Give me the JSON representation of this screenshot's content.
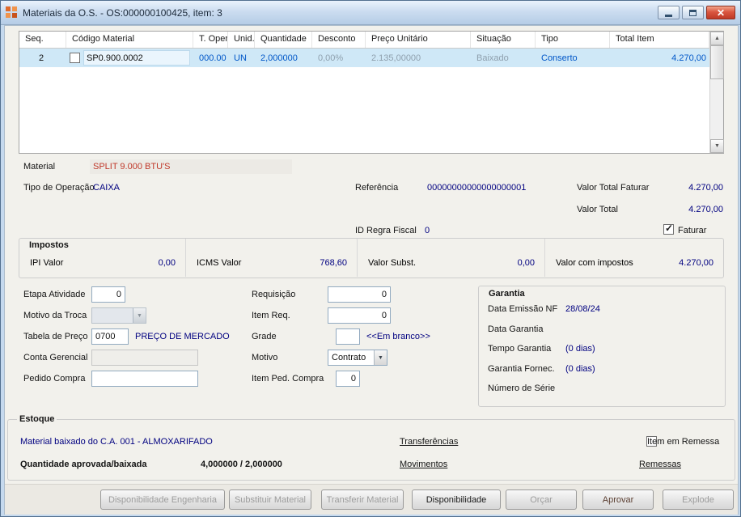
{
  "window": {
    "title": "Materiais da O.S. - OS:000000100425, item: 3"
  },
  "icons": {
    "chevron_down": "▼",
    "scroll_up": "▲",
    "scroll_down": "▼",
    "check": "✓",
    "close": "✕"
  },
  "colors": {
    "value_navy": "#000080",
    "material_red": "#c0392b",
    "row_blue": "#0057c8",
    "row_muted": "#8fa0ae",
    "selection": "#cfe8f7"
  },
  "grid": {
    "headers": [
      "Seq.",
      "Código Material",
      "T. Oper",
      "Unid.",
      "Quantidade",
      "Desconto",
      "Preço Unitário",
      "Situação",
      "Tipo",
      "Total Item"
    ],
    "row": {
      "seq": "2",
      "codigo_material": "SP0.900.0002",
      "t_oper": "000.00",
      "unid": "UN",
      "quantidade": "2,000000",
      "desconto": "0,00%",
      "preco_unitario": "2.135,00000",
      "situacao": "Baixado",
      "tipo": "Conserto",
      "total_item": "4.270,00"
    }
  },
  "detail": {
    "material_label": "Material",
    "material_value": "SPLIT 9.000 BTU'S",
    "tipo_operacao_label": "Tipo de Operação",
    "tipo_operacao_value": "CAIXA",
    "referencia_label": "Referência",
    "referencia_value": "00000000000000000001",
    "valor_total_faturar_label": "Valor Total Faturar",
    "valor_total_faturar_value": "4.270,00",
    "valor_total_label": "Valor Total",
    "valor_total_value": "4.270,00",
    "id_regra_fiscal_label": "ID Regra Fiscal",
    "id_regra_fiscal_value": "0",
    "faturar_label": "Faturar"
  },
  "impostos": {
    "title": "Impostos",
    "cells": [
      {
        "label": "IPI Valor",
        "value": "0,00"
      },
      {
        "label": "ICMS Valor",
        "value": "768,60"
      },
      {
        "label": "Valor Subst.",
        "value": "0,00"
      },
      {
        "label": "Valor com impostos",
        "value": "4.270,00"
      }
    ]
  },
  "form": {
    "etapa_atividade_label": "Etapa Atividade",
    "etapa_atividade_value": "0",
    "motivo_troca_label": "Motivo da Troca",
    "motivo_troca_value": "",
    "tabela_preco_label": "Tabela de Preço",
    "tabela_preco_value": "0700",
    "tabela_preco_desc": "PREÇO DE MERCADO",
    "conta_gerencial_label": "Conta Gerencial",
    "conta_gerencial_value": "",
    "pedido_compra_label": "Pedido Compra",
    "pedido_compra_value": "",
    "requisicao_label": "Requisição",
    "requisicao_value": "0",
    "item_req_label": "Item Req.",
    "item_req_value": "0",
    "grade_label": "Grade",
    "grade_value": "",
    "grade_hint": "<<Em branco>>",
    "motivo_label": "Motivo",
    "motivo_value": "Contrato",
    "item_ped_compra_label": "Item Ped. Compra",
    "item_ped_compra_value": "0"
  },
  "garantia": {
    "title": "Garantia",
    "data_emissao_label": "Data Emissão NF",
    "data_emissao_value": "28/08/24",
    "data_garantia_label": "Data Garantia",
    "data_garantia_value": "",
    "tempo_garantia_label": "Tempo Garantia",
    "tempo_garantia_value": "(0 dias)",
    "garantia_fornec_label": "Garantia Fornec.",
    "garantia_fornec_value": "(0 dias)",
    "numero_serie_label": "Número de Série",
    "numero_serie_value": ""
  },
  "estoque": {
    "title": "Estoque",
    "info": "Material baixado do C.A. 001 - ALMOXARIFADO",
    "qtd_label": "Quantidade aprovada/baixada",
    "qtd_value": "4,000000 / 2,000000",
    "transferencias_link": "Transferências",
    "movimentos_link": "Movimentos",
    "remessas_link": "Remessas",
    "item_remessa_label": "Item em Remessa"
  },
  "buttons": {
    "disp_engenharia": "Disponibilidade Engenharia",
    "substituir": "Substituir Material",
    "transferir": "Transferir Material",
    "disponibilidade": "Disponibilidade",
    "orcar": "Orçar",
    "aprovar": "Aprovar",
    "explode": "Explode"
  }
}
